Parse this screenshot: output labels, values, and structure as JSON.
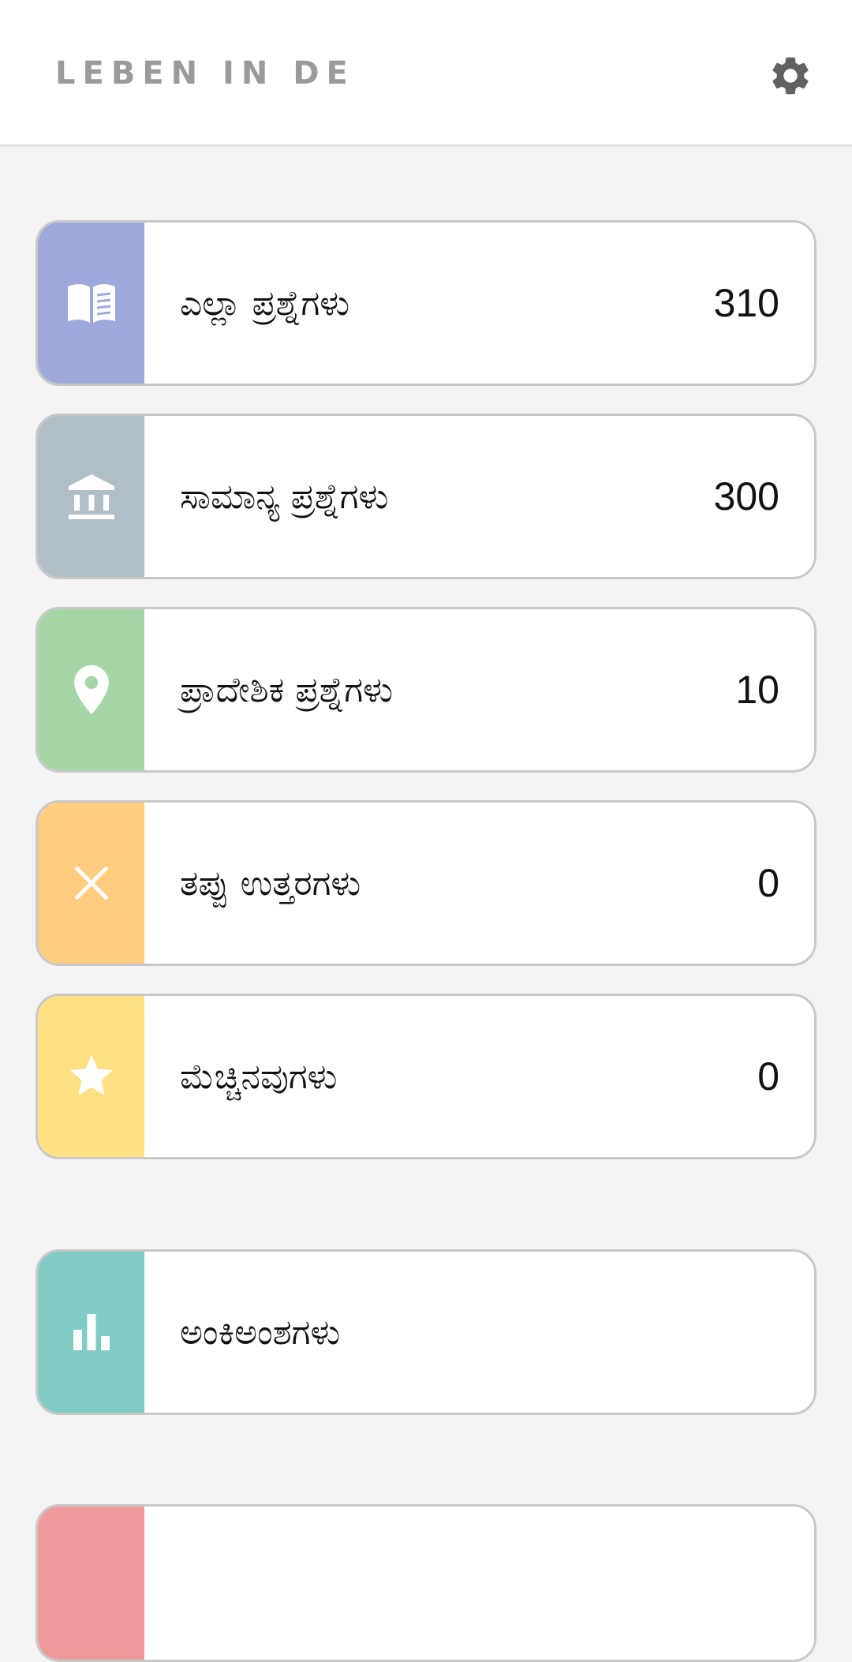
{
  "header": {
    "title": "LEBEN IN DE",
    "settings_icon": "gear-icon"
  },
  "menu": [
    {
      "id": "all-questions",
      "label": "ಎಲ್ಲಾ ಪ್ರಶ್ನೆಗಳು",
      "count": "310",
      "icon": "book-icon",
      "color": "#9fa8da"
    },
    {
      "id": "general-questions",
      "label": "ಸಾಮಾನ್ಯ ಪ್ರಶ್ನೆಗಳು",
      "count": "300",
      "icon": "bank-icon",
      "color": "#b0bec5"
    },
    {
      "id": "regional-questions",
      "label": "ಪ್ರಾದೇಶಿಕ ಪ್ರಶ್ನೆಗಳು",
      "count": "10",
      "icon": "location-pin-icon",
      "color": "#a5d6a7"
    },
    {
      "id": "wrong-answers",
      "label": "ತಪ್ಪು ಉತ್ತರಗಳು",
      "count": "0",
      "icon": "close-icon",
      "color": "#ffcc80"
    },
    {
      "id": "favorites",
      "label": "ಮೆಚ್ಚಿನವುಗಳು",
      "count": "0",
      "icon": "star-icon",
      "color": "#ffe082"
    }
  ],
  "statistics": {
    "label": "ಅಂಕಿಅಂಶಗಳು",
    "icon": "bar-chart-icon",
    "color": "#80cbc4"
  },
  "partial_card": {
    "color": "#ef9a9a"
  }
}
